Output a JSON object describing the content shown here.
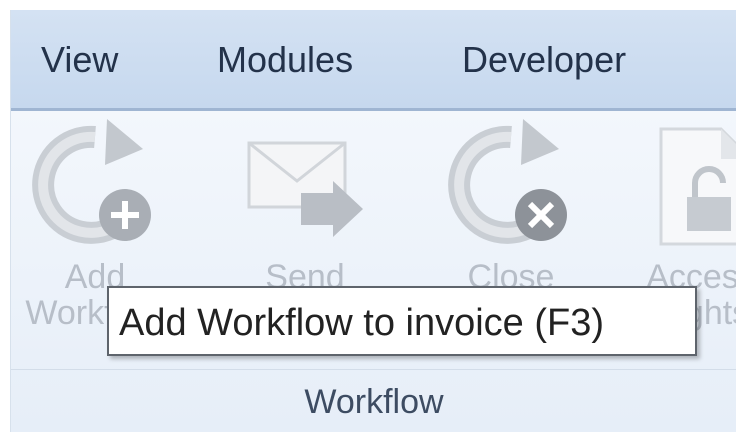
{
  "menu": {
    "items": [
      {
        "label": "View"
      },
      {
        "label": "Modules"
      },
      {
        "label": "Developer"
      }
    ]
  },
  "ribbon": {
    "buttons": [
      {
        "label": "Add Workflow",
        "icon": "add-workflow-icon",
        "disabled": true
      },
      {
        "label": "Send",
        "icon": "send-mail-icon",
        "disabled": true
      },
      {
        "label": "Close",
        "icon": "close-workflow-icon",
        "disabled": true
      },
      {
        "label": "Access Rights",
        "icon": "access-rights-icon",
        "disabled": true
      }
    ],
    "group_label": "Workflow"
  },
  "tooltip": {
    "text": "Add Workflow to invoice (F3)"
  },
  "colors": {
    "menubar": "#c8d9ee",
    "ribbon": "#edf3fa",
    "disabled_text": "#b7bec8"
  }
}
